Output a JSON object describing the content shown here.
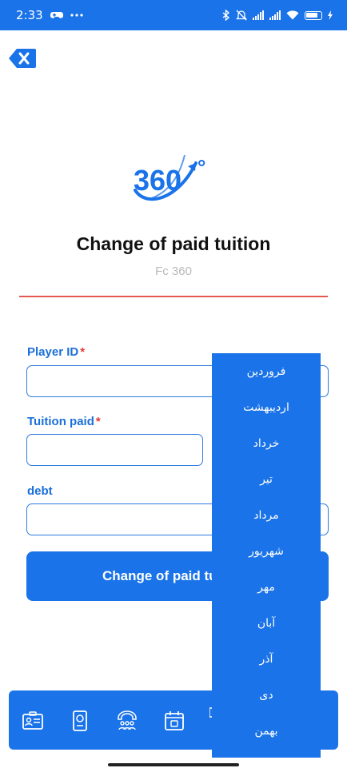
{
  "status_bar": {
    "time": "2:33",
    "icons": [
      "game-controller-icon",
      "more-dots-icon",
      "bluetooth-icon",
      "mute-icon",
      "signal-icon",
      "signal-icon",
      "wifi-icon",
      "battery-icon",
      "charging-icon"
    ]
  },
  "header": {
    "close_icon": "close-icon"
  },
  "logo": {
    "text": "360",
    "degree": "°"
  },
  "page": {
    "title": "Change of paid tuition",
    "subtitle": "Fc 360"
  },
  "form": {
    "player_id": {
      "label": "Player ID",
      "required_mark": "*",
      "value": ""
    },
    "tuition_paid": {
      "label": "Tuition paid",
      "required_mark": "*",
      "value": ""
    },
    "debt": {
      "label": "debt",
      "value": ""
    },
    "submit_label": "Change of paid tu"
  },
  "dropdown": {
    "months": [
      "فروردین",
      "اردیبهشت",
      "خرداد",
      "تیر",
      "مرداد",
      "شهریور",
      "مهر",
      "آبان",
      "آذر",
      "دی",
      "بهمن"
    ]
  },
  "bottom_nav": {
    "items": [
      "id-card-icon",
      "passport-icon",
      "team-support-icon",
      "calendar-icon"
    ]
  },
  "colors": {
    "primary": "#1a73e8",
    "accent_line": "#e4574f",
    "label": "#1a6fd8",
    "required": "#e53935",
    "subtitle": "#b9b9b9"
  }
}
